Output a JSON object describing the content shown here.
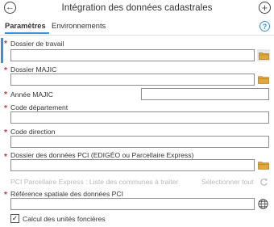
{
  "header": {
    "title": "Intégration des données cadastrales",
    "back_glyph": "←",
    "add_glyph": "+"
  },
  "tabs": {
    "parameters": "Paramètres",
    "environments": "Environnements",
    "help_glyph": "?"
  },
  "fields": {
    "dossier_travail": {
      "label": "Dossier de travail",
      "required": "*",
      "value": ""
    },
    "dossier_majic": {
      "label": "Dossier MAJIC",
      "required": "*",
      "value": ""
    },
    "annee_majic": {
      "label": "Année MAJIC",
      "required": "*",
      "value": ""
    },
    "code_departement": {
      "label": "Code département",
      "required": "*",
      "value": ""
    },
    "code_direction": {
      "label": "Code direction",
      "required": "*",
      "value": ""
    },
    "dossier_pci": {
      "label": "Dossier des données PCI (EDIGÉO ou Parcellaire Express)",
      "required": "*",
      "value": ""
    },
    "liste_communes": {
      "label": "PCI Parcellaire Express : Liste des communes à traiter",
      "select_all": "Sélectionner tout"
    },
    "reference_spatiale": {
      "label": "Référence spatiale des données PCI",
      "required": "*",
      "value": ""
    },
    "calcul_unites": {
      "label": "Calcul des unités foncières",
      "checked_glyph": "✓"
    }
  },
  "icons": {
    "folder": "folder-icon",
    "globe": "globe-icon",
    "refresh": "refresh-icon"
  },
  "colors": {
    "accent": "#3c8fd8",
    "required": "#d32f2f",
    "folder": "#e0a83a",
    "disabled_text": "#b8b8b8"
  }
}
